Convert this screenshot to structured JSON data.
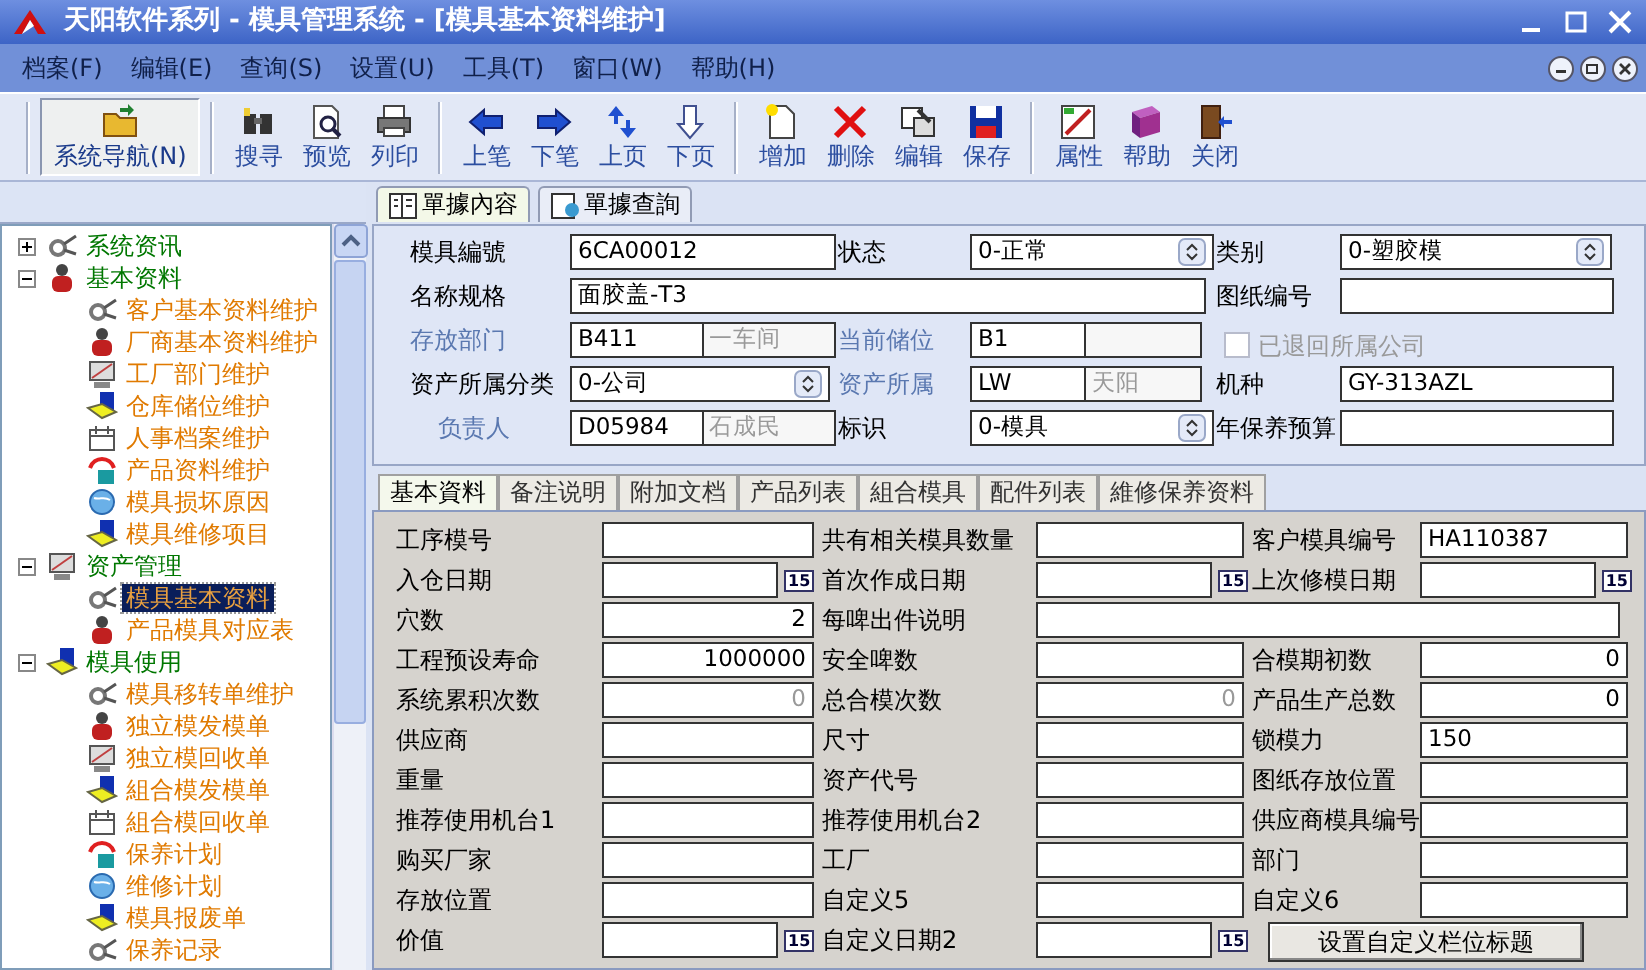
{
  "window": {
    "title": "天阳软件系列 - 模具管理系统 - [模具基本资料维护]"
  },
  "menu": [
    "档案(F)",
    "编辑(E)",
    "查询(S)",
    "设置(U)",
    "工具(T)",
    "窗口(W)",
    "帮助(H)"
  ],
  "toolbar": [
    [
      {
        "label": "系统导航(N)",
        "pressed": true
      }
    ],
    [
      {
        "label": "搜寻",
        "pressed": false
      },
      {
        "label": "预览",
        "pressed": false
      },
      {
        "label": "列印",
        "pressed": false
      }
    ],
    [
      {
        "label": "上笔",
        "pressed": false
      },
      {
        "label": "下笔",
        "pressed": false
      },
      {
        "label": "上页",
        "pressed": false
      },
      {
        "label": "下页",
        "pressed": false
      }
    ],
    [
      {
        "label": "增加",
        "pressed": false
      },
      {
        "label": "删除",
        "pressed": false
      },
      {
        "label": "编辑",
        "pressed": false
      },
      {
        "label": "保存",
        "pressed": false
      }
    ],
    [
      {
        "label": "属性",
        "pressed": false
      },
      {
        "label": "帮助",
        "pressed": false
      },
      {
        "label": "关闭",
        "pressed": false
      }
    ]
  ],
  "sidebar": {
    "tree": [
      {
        "label": "系统资讯",
        "expanded": false,
        "selected": false
      },
      {
        "label": "基本资料",
        "expanded": true,
        "selected": false,
        "children": [
          {
            "label": "客户基本资料维护",
            "selected": false
          },
          {
            "label": "厂商基本资料维护",
            "selected": false
          },
          {
            "label": "工厂部门维护",
            "selected": false
          },
          {
            "label": "仓库储位维护",
            "selected": false
          },
          {
            "label": "人事档案维护",
            "selected": false
          },
          {
            "label": "产品资料维护",
            "selected": false
          },
          {
            "label": "模具损坏原因",
            "selected": false
          },
          {
            "label": "模具维修项目",
            "selected": false
          }
        ]
      },
      {
        "label": "资产管理",
        "expanded": true,
        "selected": false,
        "children": [
          {
            "label": "模具基本资料",
            "selected": true
          },
          {
            "label": "产品模具对应表",
            "selected": false
          }
        ]
      },
      {
        "label": "模具使用",
        "expanded": true,
        "selected": false,
        "children": [
          {
            "label": "模具移转单维护",
            "selected": false
          },
          {
            "label": "独立模发模单",
            "selected": false
          },
          {
            "label": "独立模回收单",
            "selected": false
          },
          {
            "label": "組合模发模单",
            "selected": false
          },
          {
            "label": "組合模回收单",
            "selected": false
          },
          {
            "label": "保养计划",
            "selected": false
          },
          {
            "label": "维修计划",
            "selected": false
          },
          {
            "label": "模具报废单",
            "selected": false
          },
          {
            "label": "保养记录",
            "selected": false
          }
        ]
      }
    ]
  },
  "doc_tabs": [
    {
      "label": "單據內容",
      "selected": true
    },
    {
      "label": "單據查詢",
      "selected": false
    }
  ],
  "header": [
    [
      {
        "label": "模具編號",
        "link": false,
        "kind": "input",
        "value": "6CA00012"
      },
      {
        "label": "状态",
        "link": false,
        "kind": "select",
        "value": "0-正常"
      },
      {
        "label": "类别",
        "link": false,
        "kind": "select",
        "value": "0-塑胶模"
      }
    ],
    [
      {
        "label": "名称规格",
        "link": false,
        "kind": "wide",
        "value": "面胶盖-T3"
      },
      {
        "label": "图纸编号",
        "link": false,
        "kind": "input"
      }
    ],
    [
      {
        "label": "存放部门",
        "link": true,
        "kind": "pair",
        "value": "B411",
        "name": "一车间"
      },
      {
        "label": "当前储位",
        "link": true,
        "kind": "pair",
        "value": "B1"
      },
      {
        "kind": "checkbox",
        "label": "已退回所属公司",
        "checked": false,
        "disabled": true
      }
    ],
    [
      {
        "label": "资产所属分类",
        "link": false,
        "kind": "select",
        "value": "0-公司"
      },
      {
        "label": "资产所属",
        "link": true,
        "kind": "pair",
        "value": "LW",
        "name": "天阳"
      },
      {
        "label": "机种",
        "link": false,
        "kind": "input",
        "value": "GY-313AZL"
      }
    ],
    [
      {
        "label": "负责人",
        "link": true,
        "kind": "pair",
        "value": "D05984",
        "name": "石成民"
      },
      {
        "label": "标识",
        "link": false,
        "kind": "select",
        "value": "0-模具"
      },
      {
        "label": "年保养预算",
        "link": false,
        "kind": "input"
      }
    ]
  ],
  "detail_tabs": [
    {
      "label": "基本資料",
      "selected": true
    },
    {
      "label": "备注说明",
      "selected": false
    },
    {
      "label": "附加文档",
      "selected": false
    },
    {
      "label": "产品列表",
      "selected": false
    },
    {
      "label": "組合模具",
      "selected": false
    },
    {
      "label": "配件列表",
      "selected": false
    },
    {
      "label": "維修保养资料",
      "selected": false
    }
  ],
  "fields": [
    [
      {
        "label": "工序模号",
        "kind": "text"
      },
      {
        "label": "共有相关模具数量",
        "kind": "text"
      },
      {
        "label": "客户模具编号",
        "kind": "text",
        "value": "HA110387",
        "disabled": false
      }
    ],
    [
      {
        "label": "入仓日期",
        "kind": "date",
        "calendar": "15"
      },
      {
        "label": "首次作成日期",
        "kind": "date",
        "calendar": "15"
      },
      {
        "label": "上次修模日期",
        "kind": "date",
        "calendar": "15"
      }
    ],
    [
      {
        "label": "穴数",
        "kind": "number",
        "value": "2",
        "disabled": false
      },
      {
        "label": "每啤出件说明",
        "kind": "wide"
      }
    ],
    [
      {
        "label": "工程预设寿命",
        "kind": "number",
        "value": "1000000",
        "disabled": false
      },
      {
        "label": "安全啤数",
        "kind": "text"
      },
      {
        "label": "合模期初数",
        "kind": "number",
        "value": "0",
        "disabled": false
      }
    ],
    [
      {
        "label": "系统累积次数",
        "kind": "number",
        "value": "0",
        "disabled": true
      },
      {
        "label": "总合模次数",
        "kind": "number",
        "value": "0",
        "disabled": true
      },
      {
        "label": "产品生产总数",
        "kind": "number",
        "value": "0",
        "disabled": false
      }
    ],
    [
      {
        "label": "供应商",
        "kind": "text"
      },
      {
        "label": "尺寸",
        "kind": "text"
      },
      {
        "label": "锁模力",
        "kind": "text",
        "value": "150",
        "disabled": false
      }
    ],
    [
      {
        "label": "重量",
        "kind": "text"
      },
      {
        "label": "资产代号",
        "kind": "text"
      },
      {
        "label": "图纸存放位置",
        "kind": "text"
      }
    ],
    [
      {
        "label": "推荐使用机台1",
        "kind": "text"
      },
      {
        "label": "推荐使用机台2",
        "kind": "text"
      },
      {
        "label": "供应商模具编号",
        "kind": "text"
      }
    ],
    [
      {
        "label": "购买厂家",
        "kind": "text"
      },
      {
        "label": "工厂",
        "kind": "text"
      },
      {
        "label": "部门",
        "kind": "text"
      }
    ],
    [
      {
        "label": "存放位置",
        "kind": "text"
      },
      {
        "label": "自定义5",
        "kind": "text"
      },
      {
        "label": "自定义6",
        "kind": "text"
      }
    ],
    [
      {
        "label": "价值",
        "kind": "date",
        "calendar": "15"
      },
      {
        "label": "自定义日期2",
        "kind": "date",
        "calendar": "15"
      },
      {
        "label": "设置自定义栏位标题",
        "kind": "button"
      }
    ]
  ]
}
